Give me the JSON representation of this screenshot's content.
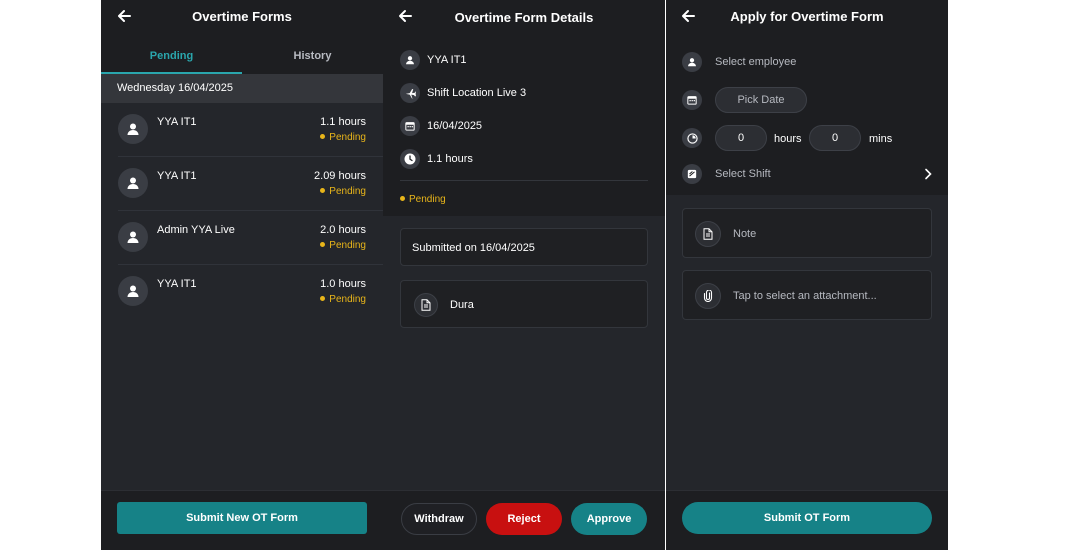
{
  "screen1": {
    "title": "Overtime Forms",
    "tabs": [
      {
        "label": "Pending",
        "active": true
      },
      {
        "label": "History",
        "active": false
      }
    ],
    "date_header": "Wednesday 16/04/2025",
    "items": [
      {
        "name": "YYA IT1",
        "hours": "1.1 hours",
        "status": "Pending"
      },
      {
        "name": "YYA IT1",
        "hours": "2.09 hours",
        "status": "Pending"
      },
      {
        "name": "Admin YYA Live",
        "hours": "2.0 hours",
        "status": "Pending"
      },
      {
        "name": "YYA IT1",
        "hours": "1.0 hours",
        "status": "Pending"
      }
    ],
    "submit_label": "Submit New OT Form"
  },
  "screen2": {
    "title": "Overtime Form Details",
    "employee": "YYA IT1",
    "location": "Shift Location Live 3",
    "date": "16/04/2025",
    "hours": "1.1 hours",
    "status": "Pending",
    "submitted": "Submitted on 16/04/2025",
    "attachment": "Dura",
    "withdraw_label": "Withdraw",
    "reject_label": "Reject",
    "approve_label": "Approve"
  },
  "screen3": {
    "title": "Apply for Overtime Form",
    "employee_placeholder": "Select employee",
    "date_placeholder": "Pick Date",
    "hours_value": "0",
    "hours_label": "hours",
    "mins_value": "0",
    "mins_label": "mins",
    "shift_placeholder": "Select Shift",
    "note_placeholder": "Note",
    "attachment_placeholder": "Tap to select an attachment...",
    "submit_label": "Submit OT Form"
  },
  "colors": {
    "accent_teal": "#168287",
    "tab_active": "#2aa6ad",
    "pending": "#e8b51a",
    "reject_red": "#c81010",
    "background": "#24262b"
  }
}
